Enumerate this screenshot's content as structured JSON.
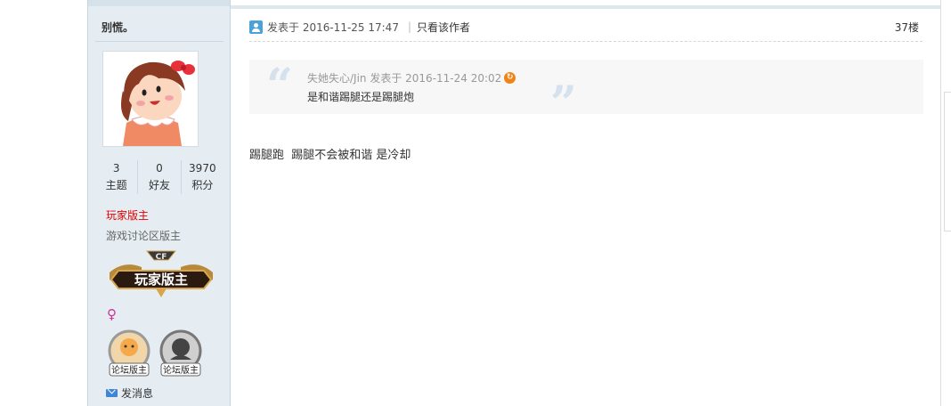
{
  "sidebar": {
    "username": "别慌。",
    "stats": [
      {
        "value": "3",
        "label": "主题"
      },
      {
        "value": "0",
        "label": "好友"
      },
      {
        "value": "3970",
        "label": "积分"
      }
    ],
    "role_primary": "玩家版主",
    "role_secondary": "游戏讨论区版主",
    "medal_text": "玩家版主",
    "medal_logo_text": "CF",
    "gender_icon": "female-icon",
    "badges": [
      {
        "label": "论坛版主",
        "icon": "moderator-badge-icon"
      },
      {
        "label": "论坛版主",
        "icon": "moderator-badge-dark-icon"
      }
    ],
    "send_message": "发消息"
  },
  "post": {
    "posted_label": "发表于 2016-11-25 17:47",
    "author_only": "只看该作者",
    "floor": "37楼",
    "quote": {
      "meta": "失她失心/Jin 发表于 2016-11-24 20:02",
      "text": "是和谐踢腿还是踢腿炮"
    },
    "body": "踢腿跑  踢腿不会被和谐 是冷却"
  },
  "colors": {
    "sidebar_bg": "#e5edf2",
    "role_primary": "#e00000",
    "quote_bg": "#f7f7f7",
    "jump_icon": "#f08419"
  }
}
